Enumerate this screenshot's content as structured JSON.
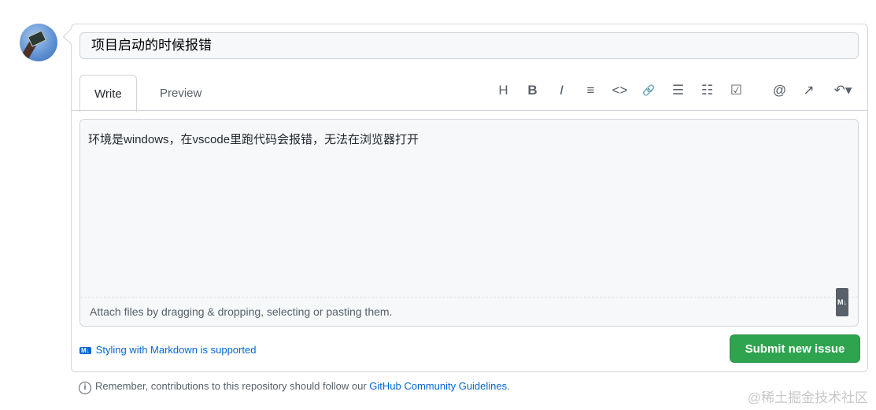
{
  "issue": {
    "title": "项目启动的时候报错",
    "body": "环境是windows，在vscode里跑代码会报错，无法在浏览器打开"
  },
  "tabs": {
    "write": "Write",
    "preview": "Preview"
  },
  "toolbar": [
    "H",
    "B",
    "I",
    "≡",
    "<>",
    "🔗",
    "☰",
    "☷",
    "☑",
    "@",
    "↗",
    "↶▾"
  ],
  "editor": {
    "attach": "Attach files by dragging & dropping, selecting or pasting them.",
    "md_badge": "M↓"
  },
  "footer": {
    "markdown_link": "Styling with Markdown is supported",
    "md_badge": "M↓",
    "submit": "Submit new issue",
    "note_prefix": "Remember, contributions to this repository should follow our ",
    "note_link": "GitHub Community Guidelines",
    "note_suffix": ".",
    "info_icon": "i"
  },
  "watermark": "@稀土掘金技术社区"
}
